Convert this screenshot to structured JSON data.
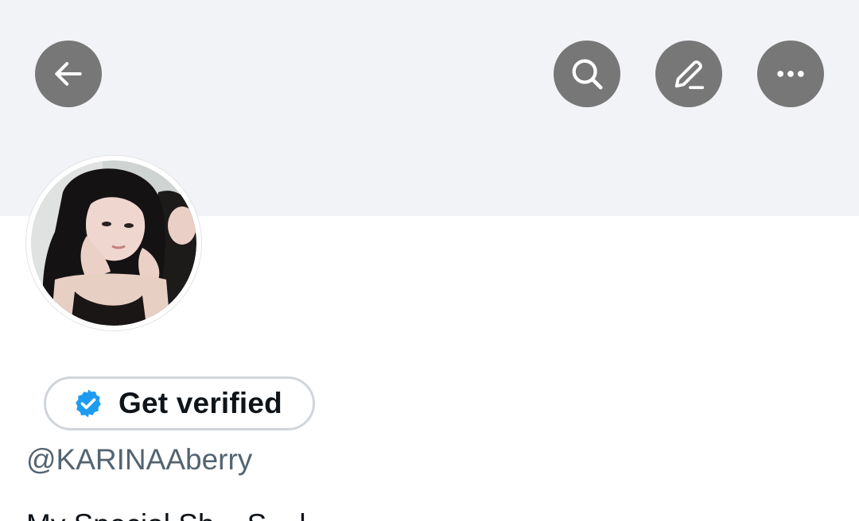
{
  "header": {
    "back_icon": "arrow-left-icon",
    "search_icon": "search-icon",
    "edit_icon": "pencil-icon",
    "more_icon": "more-horizontal-icon"
  },
  "profile": {
    "avatar": "profile-avatar",
    "verify_button_label": "Get verified",
    "verify_icon": "verified-badge-icon",
    "handle": "@KARINAAberry",
    "bio_partial": "My Special Sh...   S...   l...",
    "bio_link_partial": "..."
  },
  "colors": {
    "banner": "#f2f3f7",
    "icon_button": "#777777",
    "verified_blue": "#1d9bf0",
    "handle_gray": "#536471",
    "text": "#0f1419"
  }
}
